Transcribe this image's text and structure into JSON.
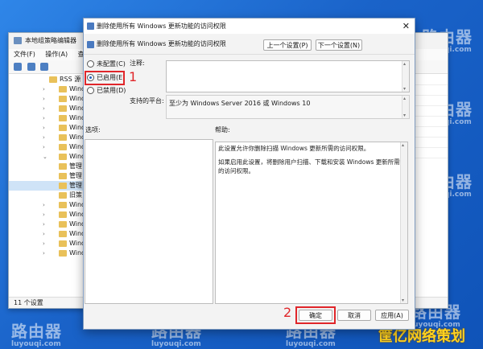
{
  "editor": {
    "title": "本地组策略编辑器",
    "menu": [
      "文件(F)",
      "操作(A)",
      "查"
    ],
    "tree": [
      "RSS 源",
      "Windo",
      "Windo",
      "Windo",
      "Windo",
      "Windo",
      "Windo",
      "Windo",
      "Windo",
      "管理",
      "管理",
      "管理",
      "旧策",
      "Windo",
      "Windo",
      "Windo",
      "Windo",
      "Windo",
      "Windo"
    ],
    "status": "11 个设置"
  },
  "dialog": {
    "title": "删除使用所有 Windows 更新功能的访问权限",
    "policy_name": "删除使用所有 Windows 更新功能的访问权限",
    "prev_button": "上一个设置(P)",
    "next_button": "下一个设置(N)",
    "options": [
      {
        "label": "未配置(C)",
        "selected": false
      },
      {
        "label": "已启用(E)",
        "selected": true
      },
      {
        "label": "已禁用(D)",
        "selected": false
      }
    ],
    "comment_label": "注释:",
    "platform_label": "支持的平台:",
    "platform_value": "至少为 Windows Server 2016 或 Windows 10",
    "options_label": "选项:",
    "help_label": "帮助:",
    "help_text": [
      "此设置允许你删除扫描 Windows 更新所需的访问权限。",
      "如果启用此设置，将删除用户扫描、下载和安装 Windows 更新所需的访问权限。"
    ],
    "ok_button": "确定",
    "cancel_button": "取消",
    "apply_button": "应用(A)"
  },
  "annotations": {
    "step1": "1",
    "step2": "2"
  },
  "watermark": {
    "brand": "路由器",
    "url": "luyouqi.com",
    "corner": "筐亿网络策划"
  },
  "colors": {
    "highlight": "#e0262a",
    "desktop": "#1a63c9"
  }
}
